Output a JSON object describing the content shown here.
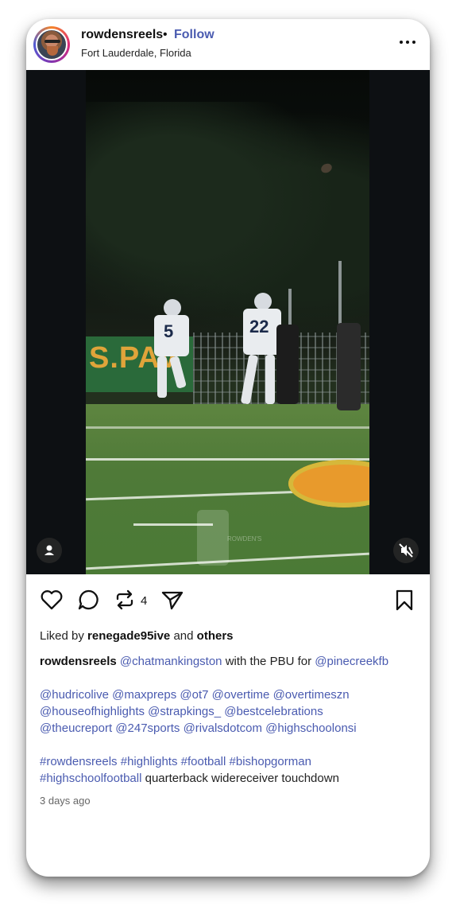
{
  "header": {
    "username": "rowdensreels",
    "separator": "•",
    "follow_label": "Follow",
    "location": "Fort Lauderdale, Florida"
  },
  "media": {
    "banner_text": "S.PAV",
    "jersey_numbers": [
      "5",
      "22"
    ],
    "watermark_text": "ROWDEN'S"
  },
  "actions": {
    "repost_count": "4"
  },
  "likes": {
    "prefix": "Liked by",
    "user": "renegade95ive",
    "middle": "and",
    "suffix": "others"
  },
  "caption": {
    "username": "rowdensreels",
    "mention1": "@chatmankingston",
    "text1": "with the PBU for",
    "mention2": "@pinecreekfb",
    "mentions_line1": [
      "@hudricolive",
      "@maxpreps",
      "@ot7",
      "@overtime",
      "@overtimeszn"
    ],
    "mentions_line2": [
      "@houseofhighlights",
      "@strapkings_",
      "@bestcelebrations"
    ],
    "mentions_line3": [
      "@theucreport",
      "@247sports",
      "@rivalsdotcom",
      "@highschoolonsi"
    ],
    "hashtags_line1": [
      "#rowdensreels",
      "#highlights",
      "#football",
      "#bishopgorman"
    ],
    "hashtag_line2": "#highschoolfootball",
    "text2": "quarterback widereceiver touchdown"
  },
  "time_ago": "3 days ago",
  "colors": {
    "accent_link": "#4a5bb0",
    "text": "#111111"
  },
  "icons": [
    "more-icon",
    "user-tag-icon",
    "mute-icon",
    "heart-icon",
    "comment-icon",
    "repost-icon",
    "share-icon",
    "bookmark-icon"
  ]
}
